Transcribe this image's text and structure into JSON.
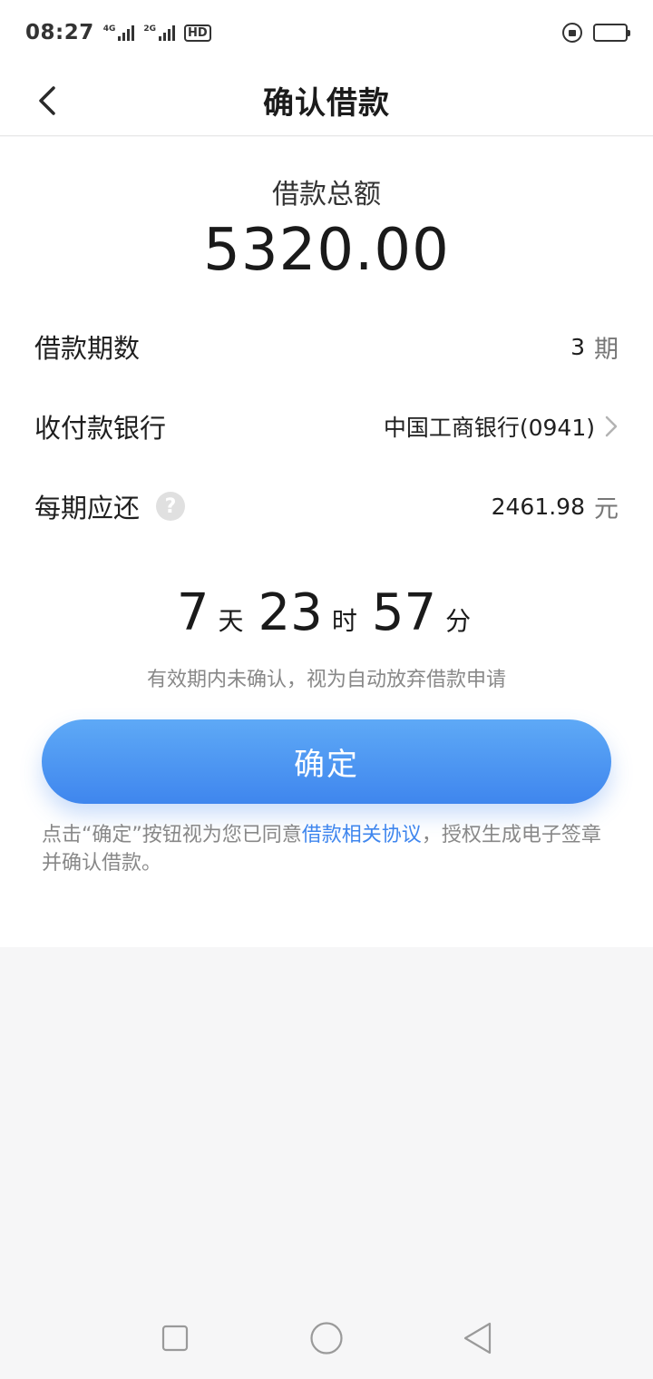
{
  "status_bar": {
    "time": "08:27",
    "sim1_label": "4G",
    "sim2_label": "2G",
    "hd_label": "HD"
  },
  "header": {
    "title": "确认借款"
  },
  "loan": {
    "total_label": "借款总额",
    "total_amount": "5320.00",
    "term_label": "借款期数",
    "term_value": "3",
    "term_unit": "期",
    "bank_label": "收付款银行",
    "bank_value": "中国工商银行(0941)",
    "per_period_label": "每期应还",
    "per_period_value": "2461.98",
    "per_period_unit": "元",
    "help_glyph": "?"
  },
  "countdown": {
    "days": "7",
    "days_unit": "天",
    "hours": "23",
    "hours_unit": "时",
    "minutes": "57",
    "minutes_unit": "分",
    "note": "有效期内未确认，视为自动放弃借款申请"
  },
  "actions": {
    "confirm_label": "确定"
  },
  "agreement": {
    "prefix": "点击“确定”按钮视为您已同意",
    "link_text": "借款相关协议",
    "suffix": "，授权生成电子签章并确认借款。"
  },
  "colors": {
    "accent": "#3f86ee",
    "accent_light": "#5ea9f6"
  },
  "icons": {
    "back": "chevron-left-icon",
    "bank_more": "chevron-right-icon",
    "help": "question-circle-icon",
    "nav_recents": "square-icon",
    "nav_home": "circle-icon",
    "nav_back": "triangle-back-icon"
  }
}
